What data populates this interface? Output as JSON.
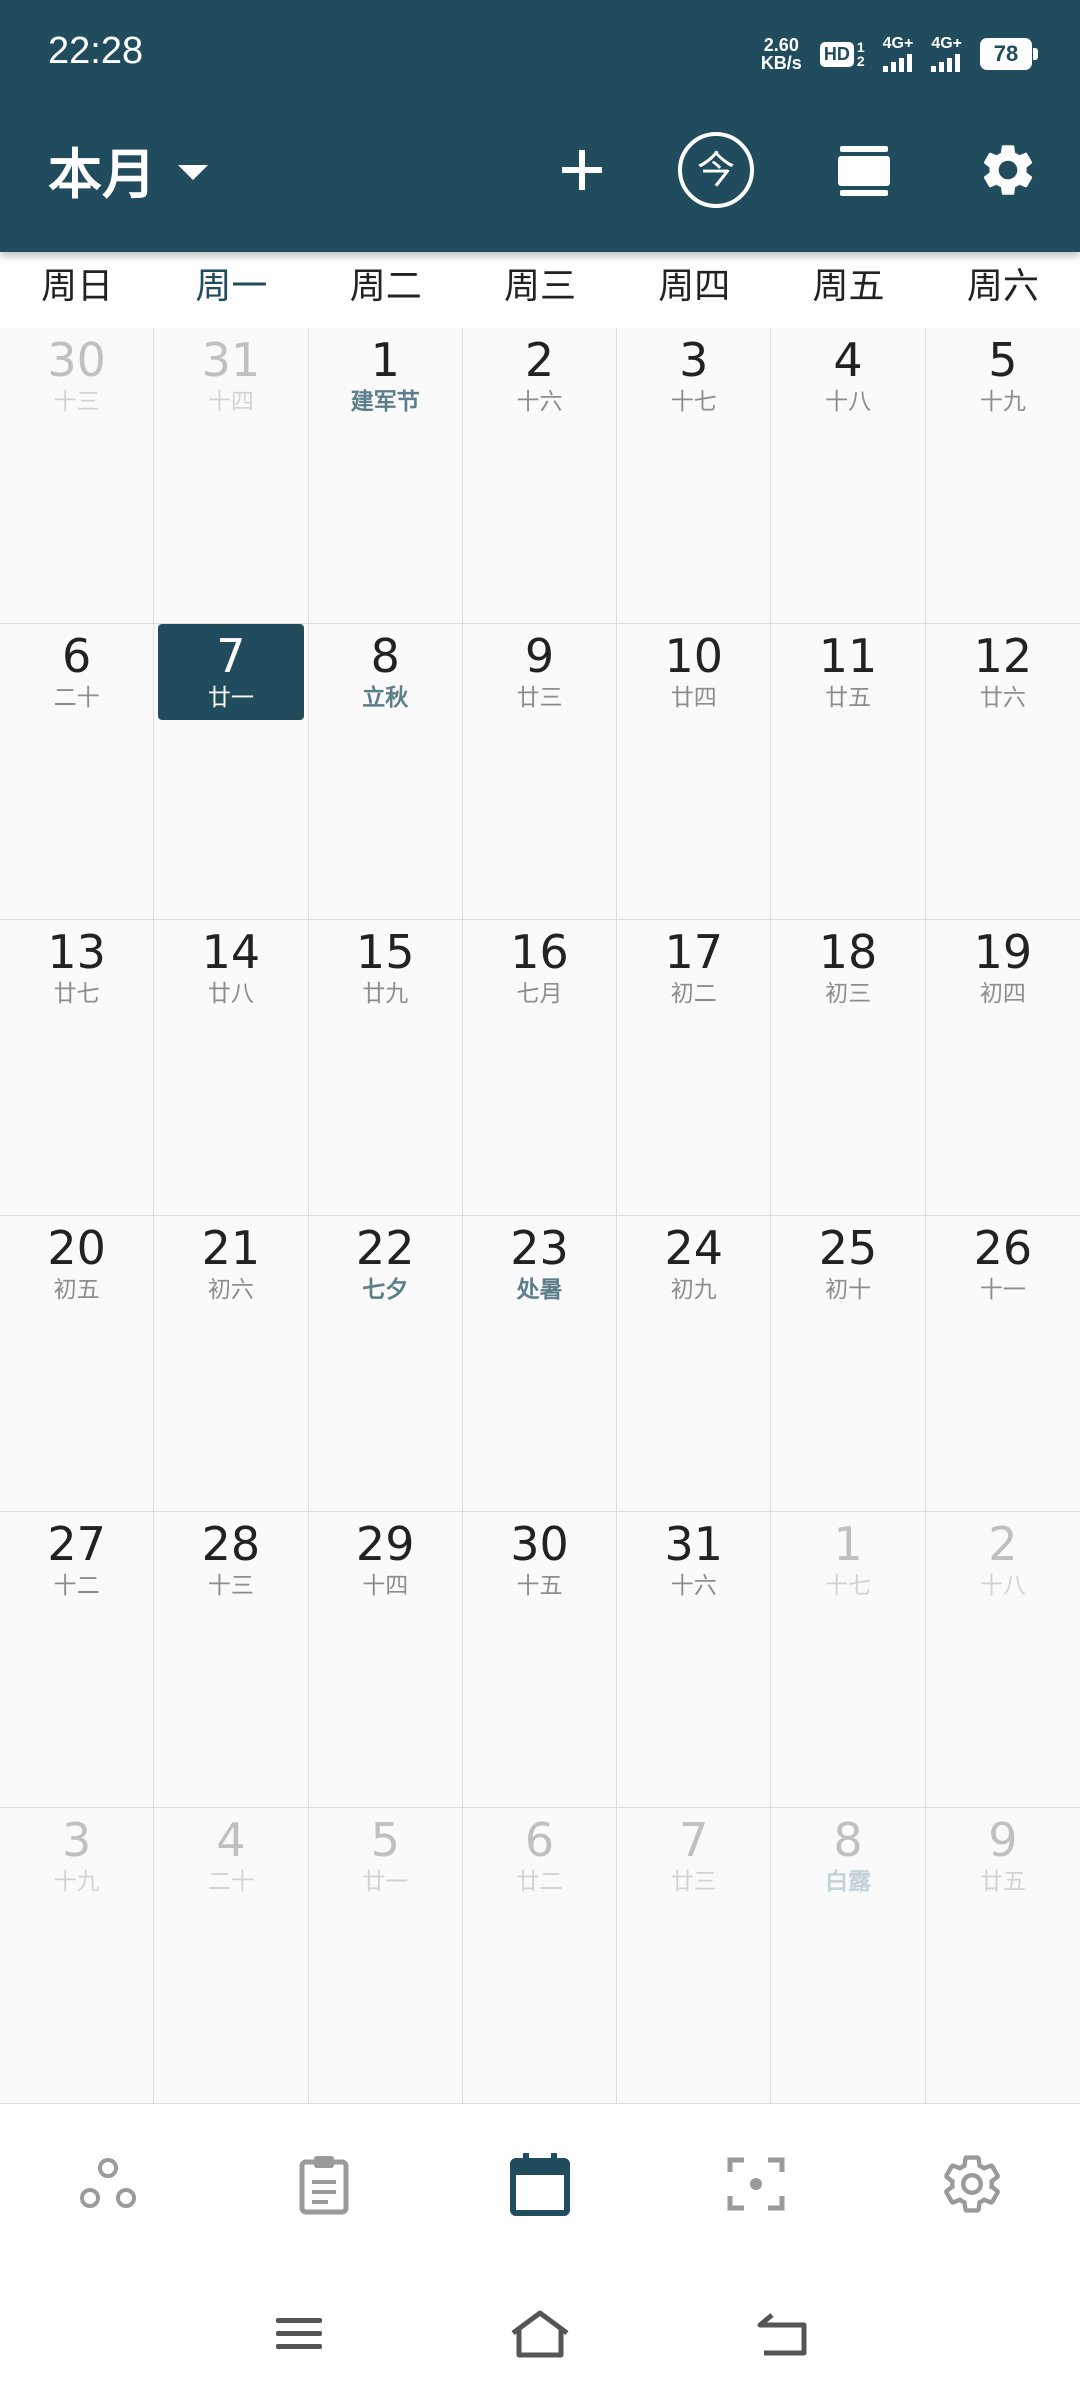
{
  "status_bar": {
    "time": "22:28",
    "net_speed_value": "2.60",
    "net_speed_unit": "KB/s",
    "hd_label": "HD",
    "hd_sub_top": "1",
    "hd_sub_bottom": "2",
    "sim1_label": "4G+",
    "sim2_label": "4G+",
    "battery_level": "78"
  },
  "header": {
    "view_title": "本月",
    "icons": [
      "add-icon",
      "today-icon",
      "view-mode-icon",
      "settings-icon"
    ]
  },
  "weekdays": [
    "周日",
    "周一",
    "周二",
    "周三",
    "周四",
    "周五",
    "周六"
  ],
  "current_weekday_index": 1,
  "weeks": [
    [
      {
        "day": "30",
        "sub": "十三",
        "other": true
      },
      {
        "day": "31",
        "sub": "十四",
        "other": true
      },
      {
        "day": "1",
        "sub": "建军节",
        "holiday": true
      },
      {
        "day": "2",
        "sub": "十六"
      },
      {
        "day": "3",
        "sub": "十七"
      },
      {
        "day": "4",
        "sub": "十八"
      },
      {
        "day": "5",
        "sub": "十九"
      }
    ],
    [
      {
        "day": "6",
        "sub": "二十"
      },
      {
        "day": "7",
        "sub": "廿一",
        "selected": true
      },
      {
        "day": "8",
        "sub": "立秋",
        "holiday": true
      },
      {
        "day": "9",
        "sub": "廿三"
      },
      {
        "day": "10",
        "sub": "廿四"
      },
      {
        "day": "11",
        "sub": "廿五"
      },
      {
        "day": "12",
        "sub": "廿六"
      }
    ],
    [
      {
        "day": "13",
        "sub": "廿七"
      },
      {
        "day": "14",
        "sub": "廿八"
      },
      {
        "day": "15",
        "sub": "廿九"
      },
      {
        "day": "16",
        "sub": "七月"
      },
      {
        "day": "17",
        "sub": "初二"
      },
      {
        "day": "18",
        "sub": "初三"
      },
      {
        "day": "19",
        "sub": "初四"
      }
    ],
    [
      {
        "day": "20",
        "sub": "初五"
      },
      {
        "day": "21",
        "sub": "初六"
      },
      {
        "day": "22",
        "sub": "七夕",
        "holiday": true
      },
      {
        "day": "23",
        "sub": "处暑",
        "holiday": true
      },
      {
        "day": "24",
        "sub": "初九"
      },
      {
        "day": "25",
        "sub": "初十"
      },
      {
        "day": "26",
        "sub": "十一"
      }
    ],
    [
      {
        "day": "27",
        "sub": "十二"
      },
      {
        "day": "28",
        "sub": "十三"
      },
      {
        "day": "29",
        "sub": "十四"
      },
      {
        "day": "30",
        "sub": "十五"
      },
      {
        "day": "31",
        "sub": "十六"
      },
      {
        "day": "1",
        "sub": "十七",
        "other": true
      },
      {
        "day": "2",
        "sub": "十八",
        "other": true
      }
    ],
    [
      {
        "day": "3",
        "sub": "十九",
        "other": true
      },
      {
        "day": "4",
        "sub": "二十",
        "other": true
      },
      {
        "day": "5",
        "sub": "廿一",
        "other": true
      },
      {
        "day": "6",
        "sub": "廿二",
        "other": true
      },
      {
        "day": "7",
        "sub": "廿三",
        "other": true
      },
      {
        "day": "8",
        "sub": "白露",
        "other": true,
        "holiday": true
      },
      {
        "day": "9",
        "sub": "廿五",
        "other": true
      }
    ]
  ],
  "bottom_nav": {
    "items": [
      "apps-icon",
      "clipboard-icon",
      "calendar-icon",
      "scan-icon",
      "gear-icon"
    ],
    "active_index": 2
  },
  "system_nav": [
    "menu-icon",
    "home-icon",
    "back-icon"
  ],
  "colors": {
    "primary": "#214c5d",
    "inactive_icon": "#9a9a9a",
    "holiday_text": "#5c7d8a"
  }
}
